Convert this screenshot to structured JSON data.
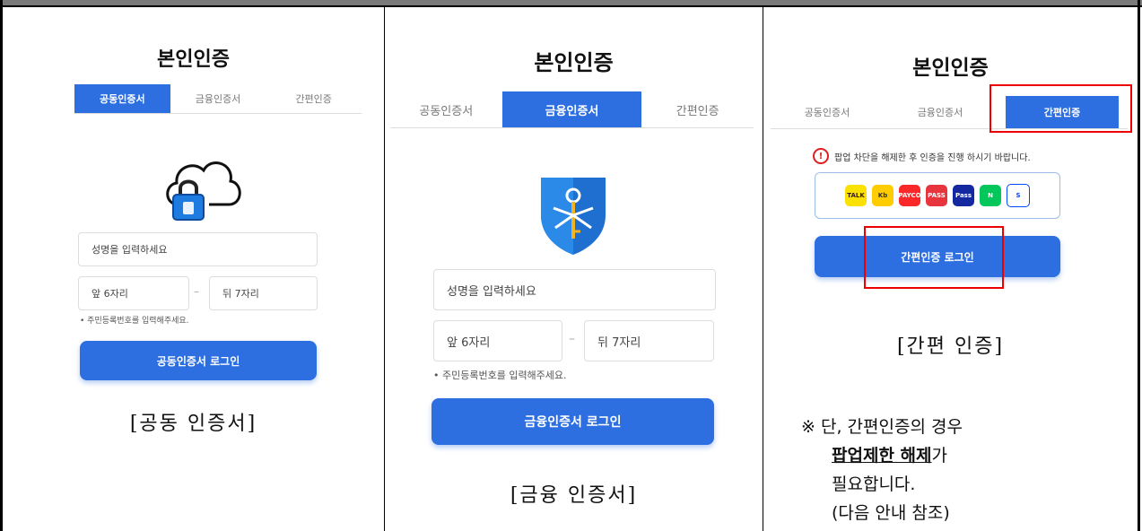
{
  "panel1": {
    "title": "본인인증",
    "tabs": [
      "공동인증서",
      "금융인증서",
      "간편인증"
    ],
    "name_placeholder": "성명을 입력하세요",
    "front_placeholder": "앞 6자리",
    "back_placeholder": "뒤 7자리",
    "dash": "–",
    "hint": "• 주민등록번호를 입력해주세요.",
    "login_button": "공동인증서 로그인",
    "caption": "[공동 인증서]"
  },
  "panel2": {
    "title": "본인인증",
    "tabs": [
      "공동인증서",
      "금융인증서",
      "간편인증"
    ],
    "name_placeholder": "성명을 입력하세요",
    "front_placeholder": "앞 6자리",
    "back_placeholder": "뒤 7자리",
    "dash": "–",
    "hint": "• 주민등록번호를 입력해주세요.",
    "login_button": "금융인증서 로그인",
    "caption": "[금융 인증서]"
  },
  "panel3": {
    "title": "본인인증",
    "tabs": [
      "공동인증서",
      "금융인증서",
      "간편인증"
    ],
    "warning": "팝업 차단을 해제한 후 인증을 진행 하시기 바랍니다.",
    "providers": [
      {
        "name": "TALK",
        "bg": "#fae100",
        "fg": "#3a1d1d"
      },
      {
        "name": "Kb",
        "bg": "#ffcc00",
        "fg": "#333"
      },
      {
        "name": "PAYCO",
        "bg": "#fa2828",
        "fg": "#fff"
      },
      {
        "name": "PASS",
        "bg": "#e8343c",
        "fg": "#fff"
      },
      {
        "name": "Pass",
        "bg": "#1428a0",
        "fg": "#fff"
      },
      {
        "name": "N",
        "bg": "#03c75a",
        "fg": "#fff"
      },
      {
        "name": "S",
        "bg": "#ffffff",
        "fg": "#0046ff"
      }
    ],
    "login_button": "간편인증 로그인",
    "caption": "[간편 인증]",
    "note_line1_prefix": "※ 단, 간편인증의 경우",
    "note_line2_bold": "팝업제한 해제",
    "note_line2_suffix": "가",
    "note_line3": "필요합니다.",
    "note_line4": "(다음 안내 참조)"
  },
  "colors": {
    "accent": "#2d6fe0",
    "highlight": "#e00000"
  }
}
